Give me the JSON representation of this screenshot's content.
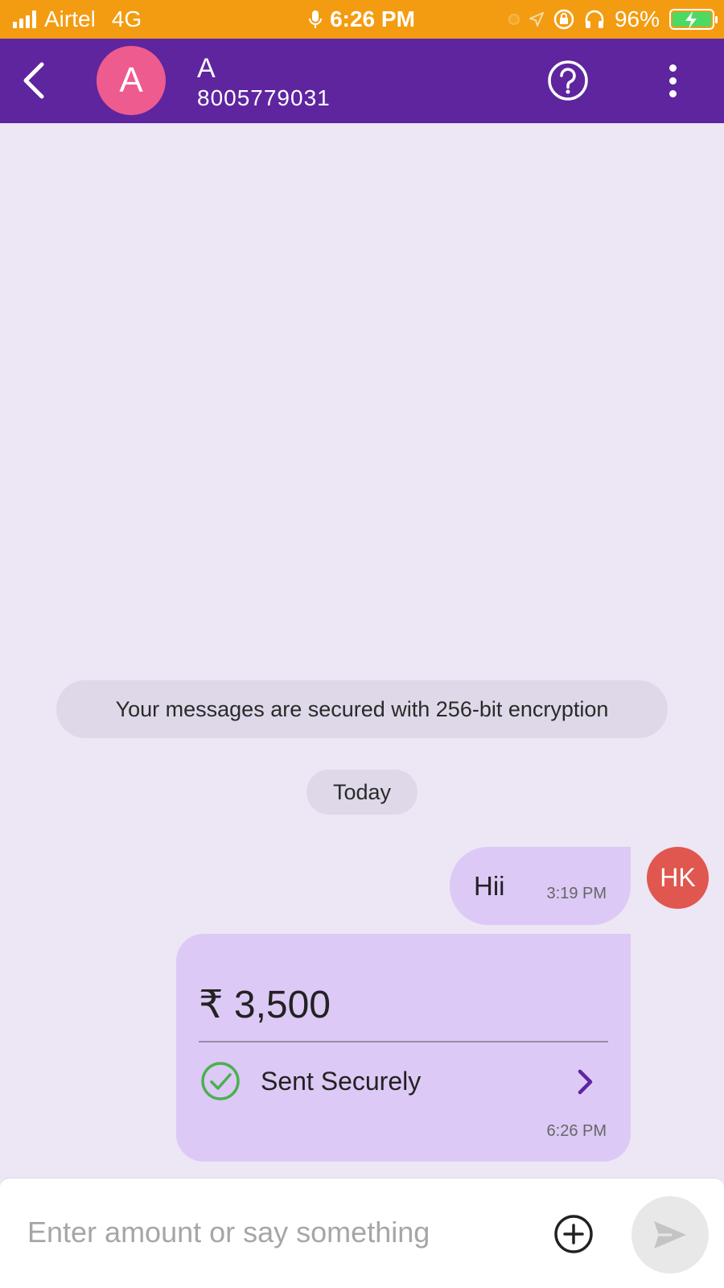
{
  "status_bar": {
    "carrier": "Airtel",
    "network": "4G",
    "time": "6:26 PM",
    "battery": "96%"
  },
  "header": {
    "avatar_letter": "A",
    "contact_name": "A",
    "contact_phone": "8005779031"
  },
  "chat": {
    "encryption_notice": "Your messages are secured with 256-bit encryption",
    "date_divider": "Today",
    "message": {
      "text": "Hii",
      "time": "3:19 PM",
      "sender_initials": "HK"
    },
    "payment": {
      "amount": "₹ 3,500",
      "status": "Sent Securely",
      "time": "6:26 PM"
    }
  },
  "input": {
    "placeholder": "Enter amount or say something"
  },
  "colors": {
    "status_bar_bg": "#f39c12",
    "header_bg": "#5f259f",
    "chat_bg": "#ede6f5",
    "bubble_bg": "#dcc9f5",
    "avatar_a_bg": "#ee5b8f",
    "avatar_hk_bg": "#e0574f",
    "success_green": "#4caf50"
  },
  "icons": {
    "back": "chevron-left-icon",
    "help": "question-circle-icon",
    "more": "more-vertical-icon",
    "check": "check-circle-icon",
    "chevron": "chevron-right-icon",
    "plus": "plus-circle-icon",
    "send": "send-icon"
  }
}
